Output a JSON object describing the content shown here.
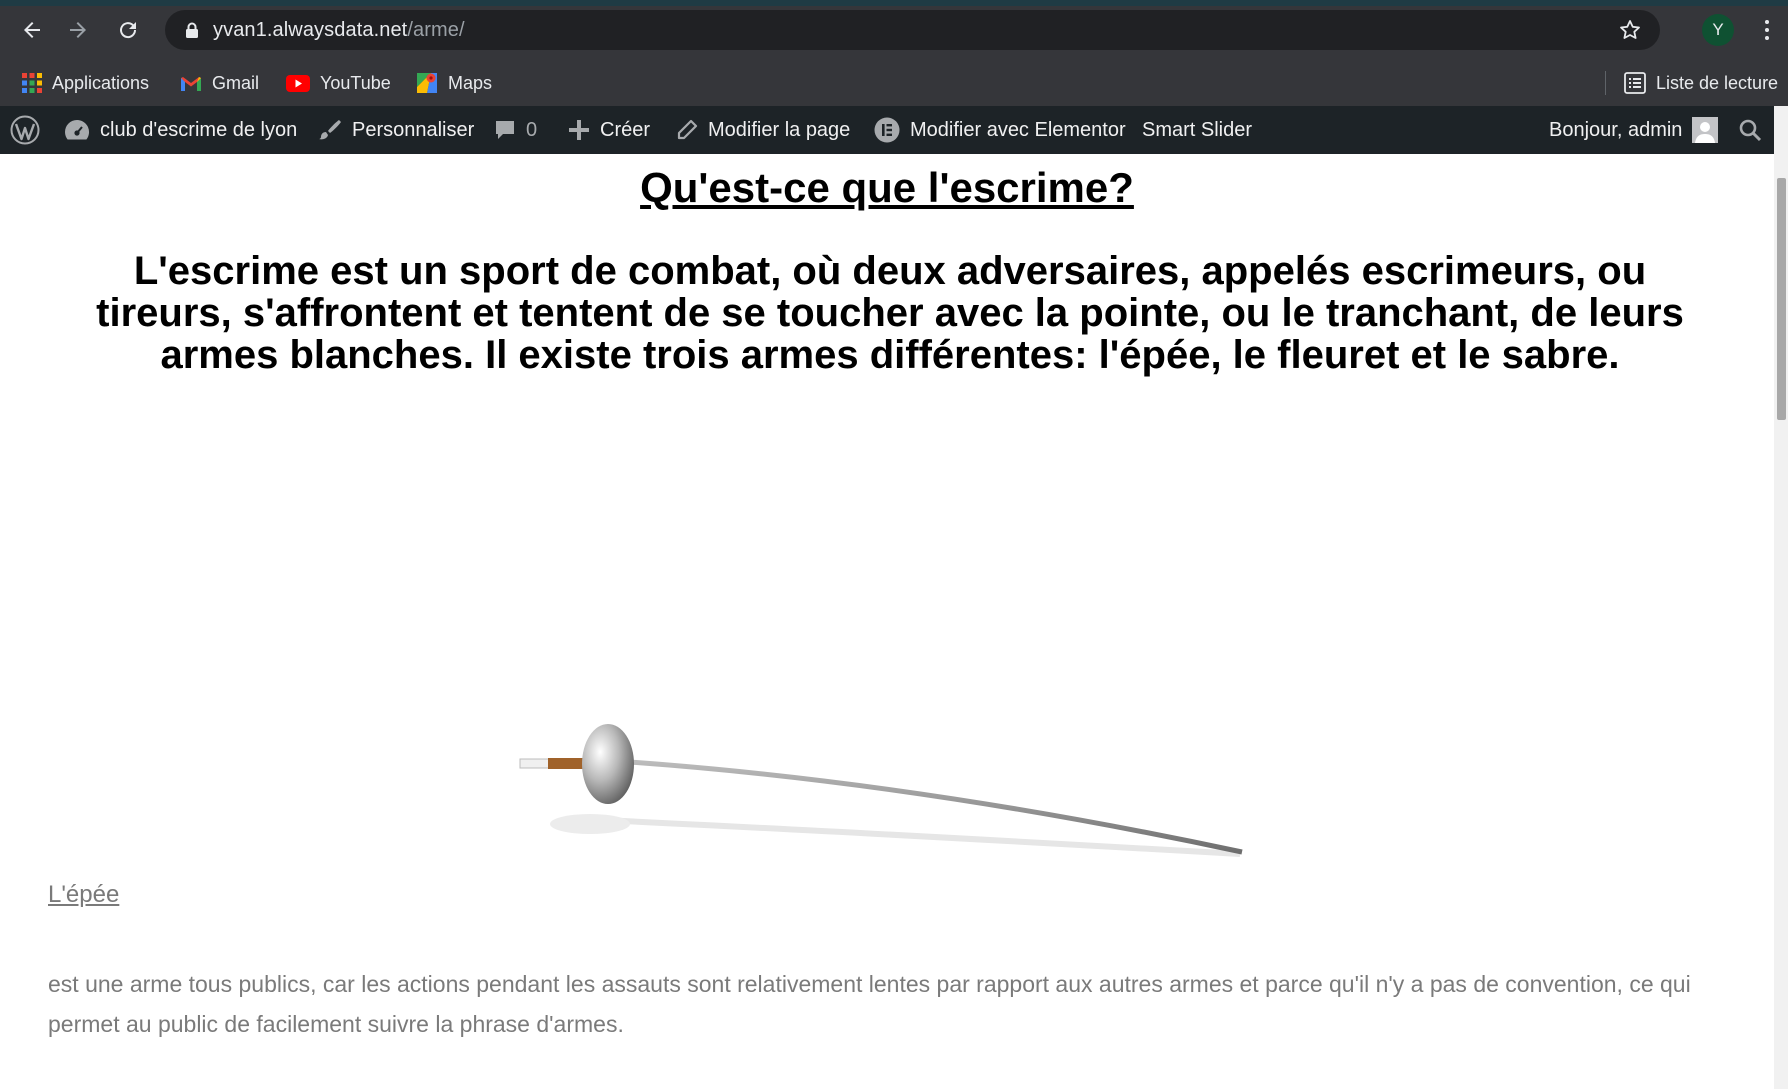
{
  "browser": {
    "url_host": "yvan1.alwaysdata.net",
    "url_path": "/arme/",
    "profile_initial": "Y",
    "icons": {
      "back": "arrow-left-icon",
      "forward": "arrow-right-icon",
      "reload": "reload-icon",
      "lock": "lock-icon",
      "bookmark": "star-icon",
      "menu": "kebab-menu-icon"
    }
  },
  "bookmarks": {
    "items": [
      {
        "label": "Applications",
        "icon": "apps-grid-icon"
      },
      {
        "label": "Gmail",
        "icon": "gmail-icon"
      },
      {
        "label": "YouTube",
        "icon": "youtube-icon"
      },
      {
        "label": "Maps",
        "icon": "maps-icon"
      }
    ],
    "reading_list": {
      "label": "Liste de lecture",
      "icon": "reading-list-icon"
    }
  },
  "wp_admin_bar": {
    "site_name": "club d'escrime de lyon",
    "customize": "Personnaliser",
    "comments_count": "0",
    "new": "Créer",
    "edit_page": "Modifier la page",
    "elementor": "Modifier avec Elementor",
    "smart_slider": "Smart Slider",
    "greeting": "Bonjour, admin"
  },
  "page": {
    "heading": "Qu'est-ce que l'escrime?",
    "intro": "L'escrime est un sport de combat, où deux adversaires, appelés escrimeurs, ou tireurs, s'affrontent et tentent de se toucher avec la pointe, ou le tranchant, de leurs armes blanches. Il existe trois armes différentes: l'épée, le fleuret et le sabre.",
    "image_alt": "épée",
    "caption": "L'épée",
    "paragraph": "est une arme tous publics, car les actions pendant les assauts sont relativement lentes par rapport aux autres armes et parce qu'il n'y a pas de convention, ce qui permet au public de facilement suivre la phrase d'armes."
  },
  "colors": {
    "chrome_bg": "#35363a",
    "omnibox_bg": "#202124",
    "wp_bar_bg": "#1d2327",
    "body_text": "#7a7a7a"
  }
}
